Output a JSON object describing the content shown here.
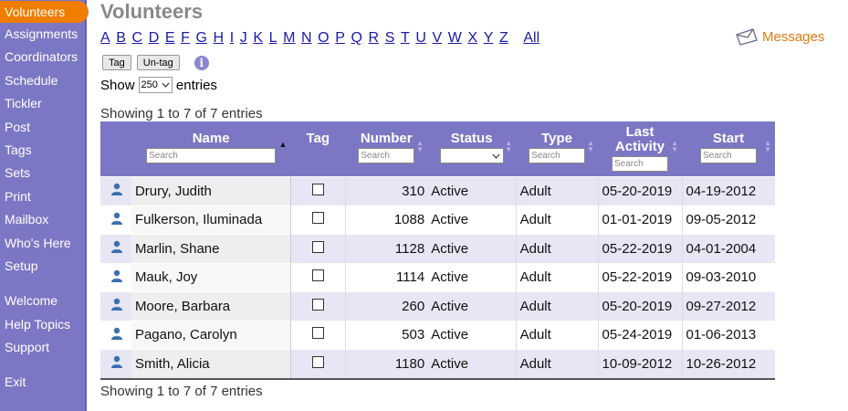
{
  "sidebar": {
    "items": [
      "Volunteers",
      "Assignments",
      "Coordinators",
      "Schedule",
      "Tickler",
      "Post",
      "Tags",
      "Sets",
      "Print",
      "Mailbox",
      "Who's Here",
      "Setup"
    ],
    "items2": [
      "Welcome",
      "Help Topics",
      "Support"
    ],
    "exit": "Exit",
    "accent": "#ef7d00"
  },
  "page": {
    "title": "Volunteers",
    "letters": [
      "A",
      "B",
      "C",
      "D",
      "E",
      "F",
      "G",
      "H",
      "I",
      "J",
      "K",
      "L",
      "M",
      "N",
      "O",
      "P",
      "Q",
      "R",
      "S",
      "T",
      "U",
      "V",
      "W",
      "X",
      "Y",
      "Z"
    ],
    "all_label": "All",
    "messages_label": "Messages",
    "tag_button": "Tag",
    "untag_button": "Un-tag",
    "info_glyph": "i",
    "show_label": "Show",
    "entries_value": "250",
    "entries_label": "entries",
    "info_text": "Showing 1 to 7 of 7 entries"
  },
  "table": {
    "headers": {
      "name": "Name",
      "tag": "Tag",
      "number": "Number",
      "status": "Status",
      "type": "Type",
      "last1": "Last",
      "last2": "Activity",
      "start": "Start"
    },
    "search_placeholder": "Search",
    "rows": [
      {
        "name": "Drury, Judith",
        "number": "310",
        "status": "Active",
        "type": "Adult",
        "last": "05-20-2019",
        "start": "04-19-2012"
      },
      {
        "name": "Fulkerson, Iluminada",
        "number": "1088",
        "status": "Active",
        "type": "Adult",
        "last": "01-01-2019",
        "start": "09-05-2012"
      },
      {
        "name": "Marlin, Shane",
        "number": "1128",
        "status": "Active",
        "type": "Adult",
        "last": "05-22-2019",
        "start": "04-01-2004"
      },
      {
        "name": "Mauk, Joy",
        "number": "1114",
        "status": "Active",
        "type": "Adult",
        "last": "05-22-2019",
        "start": "09-03-2010"
      },
      {
        "name": "Moore, Barbara",
        "number": "260",
        "status": "Active",
        "type": "Adult",
        "last": "05-20-2019",
        "start": "09-27-2012"
      },
      {
        "name": "Pagano, Carolyn",
        "number": "503",
        "status": "Active",
        "type": "Adult",
        "last": "05-24-2019",
        "start": "01-06-2013"
      },
      {
        "name": "Smith, Alicia",
        "number": "1180",
        "status": "Active",
        "type": "Adult",
        "last": "10-09-2012",
        "start": "10-26-2012"
      }
    ]
  }
}
